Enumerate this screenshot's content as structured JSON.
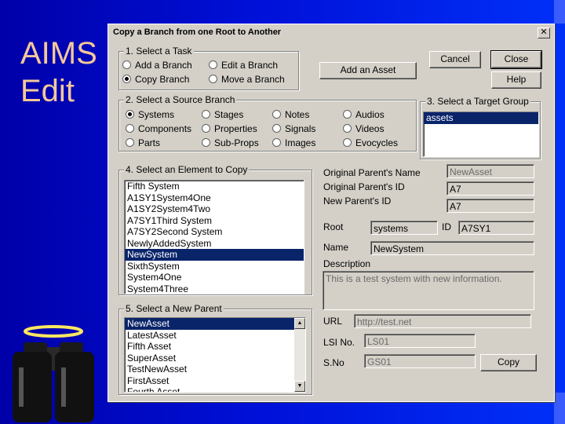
{
  "slide": {
    "title_line1": "AIMS",
    "title_line2": "Edit"
  },
  "dialog": {
    "title": "Copy a Branch from one Root to Another",
    "close_glyph": "✕",
    "task": {
      "legend": "1. Select a Task",
      "options": [
        {
          "label": "Add a Branch",
          "selected": false
        },
        {
          "label": "Edit a Branch",
          "selected": false
        },
        {
          "label": "Copy Branch",
          "selected": true
        },
        {
          "label": "Move a Branch",
          "selected": false
        }
      ]
    },
    "buttons": {
      "add_asset": "Add an Asset",
      "cancel": "Cancel",
      "close": "Close",
      "help": "Help",
      "copy": "Copy"
    },
    "source": {
      "legend": "2. Select a Source Branch",
      "options": [
        {
          "label": "Systems",
          "selected": true
        },
        {
          "label": "Stages",
          "selected": false
        },
        {
          "label": "Notes",
          "selected": false
        },
        {
          "label": "Audios",
          "selected": false
        },
        {
          "label": "Components",
          "selected": false
        },
        {
          "label": "Properties",
          "selected": false
        },
        {
          "label": "Signals",
          "selected": false
        },
        {
          "label": "Videos",
          "selected": false
        },
        {
          "label": "Parts",
          "selected": false
        },
        {
          "label": "Sub-Props",
          "selected": false
        },
        {
          "label": "Images",
          "selected": false
        },
        {
          "label": "Evocycles",
          "selected": false
        }
      ]
    },
    "target": {
      "legend": "3. Select a Target Group",
      "items": [
        "assets"
      ],
      "selected_index": 0
    },
    "element": {
      "legend": "4. Select an Element to Copy",
      "items": [
        "Fifth System",
        "A1SY1System4One",
        "A1SY2System4Two",
        "A7SY1Third System",
        "A7SY2Second System",
        "NewlyAddedSystem",
        "NewSystem",
        "SixthSystem",
        "System4One",
        "System4Three"
      ],
      "selected_index": 6
    },
    "parent": {
      "legend": "5. Select a New Parent",
      "items": [
        "NewAsset",
        "LatestAsset",
        "Fifth Asset",
        "SuperAsset",
        "TestNewAsset",
        "FirstAsset",
        "Fourth Asset"
      ],
      "selected_index": 0
    },
    "details": {
      "orig_parent_name_label": "Original Parent's Name",
      "orig_parent_name_value": "NewAsset",
      "orig_parent_id_label": "Original Parent's ID",
      "orig_parent_id_value": "A7",
      "new_parent_id_label": "New Parent's ID",
      "new_parent_id_value": "A7",
      "root_label": "Root",
      "root_value": "systems",
      "id_label": "ID",
      "id_value": "A7SY1",
      "name_label": "Name",
      "name_value": "NewSystem",
      "description_label": "Description",
      "description_value": "This is a test system with new information.",
      "url_label": "URL",
      "url_value": "http://test.net",
      "lsi_label": "LSI No.",
      "lsi_value": "LS01",
      "sno_label": "S.No",
      "sno_value": "GS01"
    }
  },
  "colors": {
    "background": "#0010d8",
    "title_text": "#f5c89a",
    "dialog": "#d4d0c8",
    "selection": "#0a246a"
  }
}
